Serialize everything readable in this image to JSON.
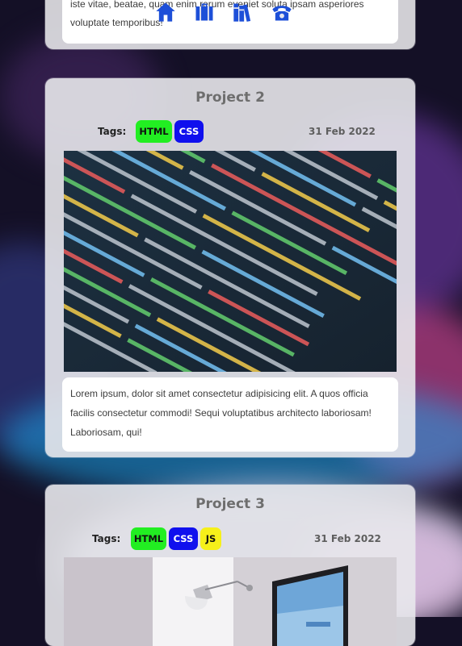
{
  "nav": {
    "items": [
      {
        "icon": "home-icon"
      },
      {
        "icon": "briefcase-icon"
      },
      {
        "icon": "books-icon"
      },
      {
        "icon": "phone-icon"
      }
    ],
    "color": "#1d4fd8"
  },
  "project1": {
    "description": "iste vitae, beatae, quam enim rerum eveniet soluta ipsam asperiores voluptate temporibus!"
  },
  "project2": {
    "title": "Project 2",
    "tags_label": "Tags:",
    "tags": [
      "HTML",
      "CSS"
    ],
    "date": "31 Feb 2022",
    "image": "code-screen-image",
    "description": "Lorem ipsum, dolor sit amet consectetur adipisicing elit. A quos officia facilis consectetur commodi! Sequi voluptatibus architecto laboriosam! Laboriosam, qui!"
  },
  "project3": {
    "title": "Project 3",
    "tags_label": "Tags:",
    "tags": [
      "HTML",
      "CSS",
      "JS"
    ],
    "date": "31 Feb 2022",
    "image": "desk-lamp-monitor-image"
  },
  "colors": {
    "tag_html": "#22ee22",
    "tag_css": "#1010ee",
    "tag_js": "#f6f01a"
  }
}
